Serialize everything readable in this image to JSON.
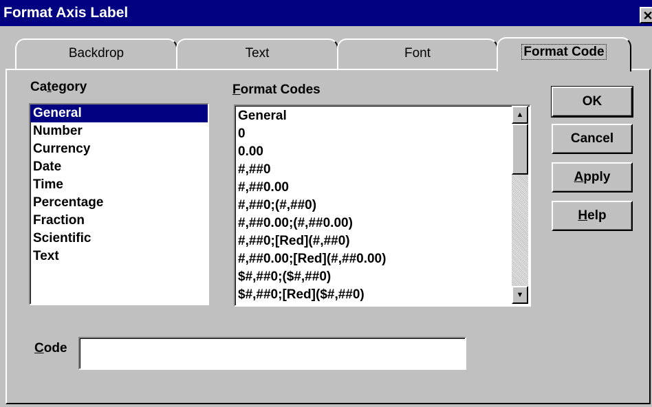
{
  "window": {
    "title": "Format Axis Label",
    "close_glyph": "✕"
  },
  "tabs": [
    {
      "label": "Backdrop",
      "active": false
    },
    {
      "label": "Text",
      "active": false
    },
    {
      "label": "Font",
      "active": false
    },
    {
      "label": "Format Code",
      "active": true
    }
  ],
  "category": {
    "label_pre": "Ca",
    "label_key": "t",
    "label_post": "egory",
    "items": [
      "General",
      "Number",
      "Currency",
      "Date",
      "Time",
      "Percentage",
      "Fraction",
      "Scientific",
      "Text"
    ],
    "selected_index": 0
  },
  "format_codes": {
    "label_key": "F",
    "label_post": "ormat Codes",
    "items": [
      "General",
      "0",
      "0.00",
      "#,##0",
      "#,##0.00",
      "#,##0;(#,##0)",
      "#,##0.00;(#,##0.00)",
      "#,##0;[Red](#,##0)",
      "#,##0.00;[Red](#,##0.00)",
      "$#,##0;($#,##0)",
      "$#,##0;[Red]($#,##0)"
    ]
  },
  "code": {
    "label_key": "C",
    "label_post": "ode",
    "value": ""
  },
  "buttons": {
    "ok": "OK",
    "cancel": "Cancel",
    "apply_key": "A",
    "apply_post": "pply",
    "help_key": "H",
    "help_post": "elp"
  },
  "icons": {
    "scroll_up": "▲",
    "scroll_down": "▼"
  }
}
